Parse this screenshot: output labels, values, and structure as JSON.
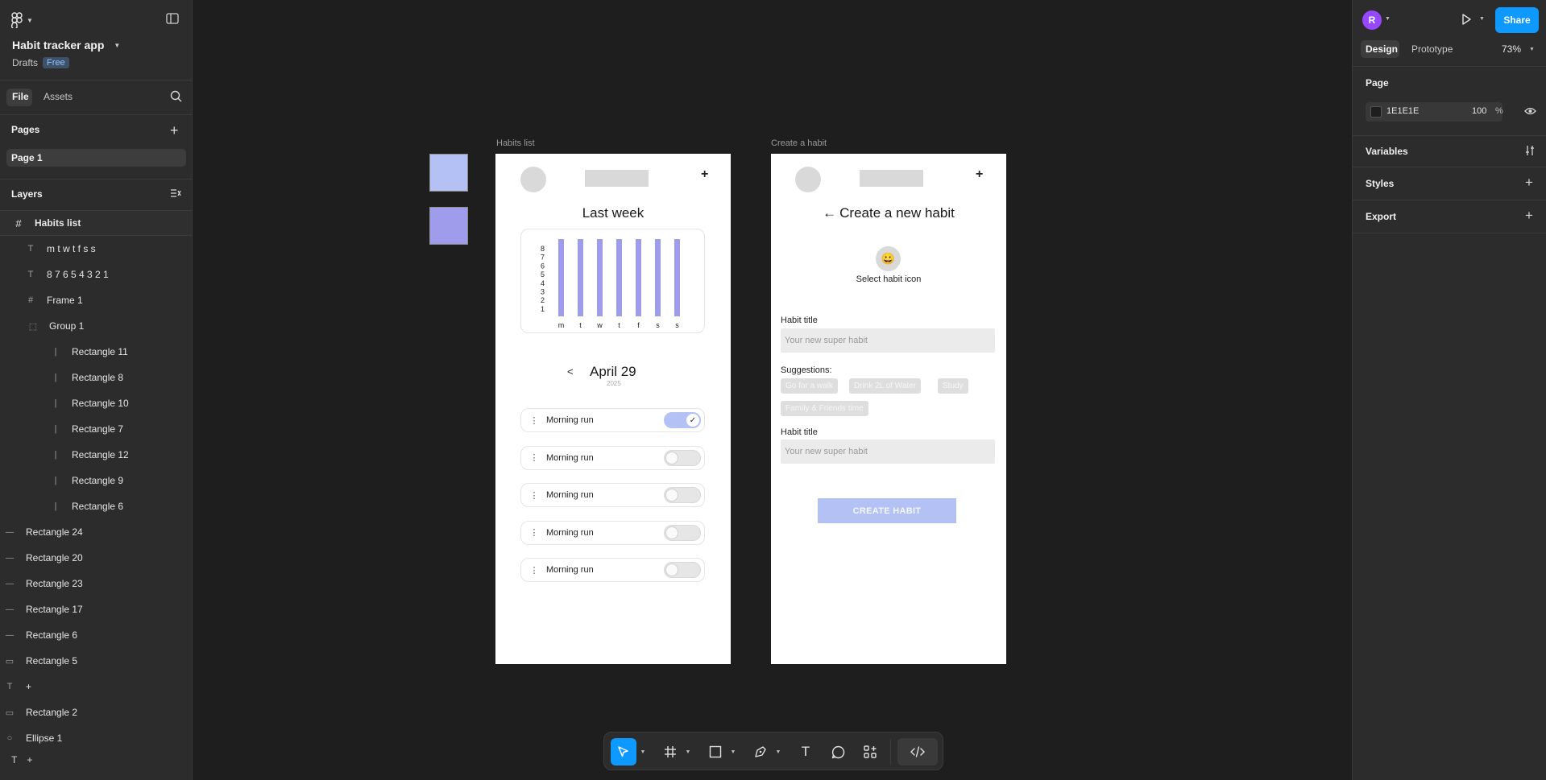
{
  "file": {
    "title": "Habit tracker app",
    "location": "Drafts",
    "plan_badge": "Free"
  },
  "left_tabs": {
    "file": "File",
    "assets": "Assets"
  },
  "pages": {
    "header": "Pages",
    "items": [
      "Page 1"
    ]
  },
  "layers": {
    "header": "Layers",
    "root": "Habits list",
    "items": [
      {
        "icon": "text-icon",
        "name": "m t w t f s s"
      },
      {
        "icon": "text-icon",
        "name": "8 7 6 5 4 3 2 1"
      },
      {
        "icon": "frame-icon",
        "name": "Frame 1"
      },
      {
        "icon": "group-icon",
        "name": "Group 1"
      },
      {
        "icon": "vline-icon",
        "name": "Rectangle 11"
      },
      {
        "icon": "vline-icon",
        "name": "Rectangle 8"
      },
      {
        "icon": "vline-icon",
        "name": "Rectangle 10"
      },
      {
        "icon": "vline-icon",
        "name": "Rectangle 7"
      },
      {
        "icon": "vline-icon",
        "name": "Rectangle 12"
      },
      {
        "icon": "vline-icon",
        "name": "Rectangle 9"
      },
      {
        "icon": "vline-icon",
        "name": "Rectangle 6"
      },
      {
        "icon": "hline-icon",
        "name": "Rectangle 24"
      },
      {
        "icon": "hline-icon",
        "name": "Rectangle 20"
      },
      {
        "icon": "hline-icon",
        "name": "Rectangle 23"
      },
      {
        "icon": "hline-icon",
        "name": "Rectangle 17"
      },
      {
        "icon": "hline-icon",
        "name": "Rectangle 6"
      },
      {
        "icon": "rect-icon",
        "name": "Rectangle 5"
      },
      {
        "icon": "text-icon",
        "name": "+"
      },
      {
        "icon": "rect-thin-icon",
        "name": "Rectangle 2"
      },
      {
        "icon": "ellipse-icon",
        "name": "Ellipse 1"
      }
    ],
    "bottom": "+"
  },
  "right": {
    "user_initial": "R",
    "share": "Share",
    "tabs": {
      "design": "Design",
      "prototype": "Prototype"
    },
    "zoom": "73%",
    "page_header": "Page",
    "page_color": "1E1E1E",
    "page_opacity": "100",
    "percent": "%",
    "variables": "Variables",
    "styles": "Styles",
    "export": "Export"
  },
  "canvas": {
    "swatches": [
      "#b4c1f5",
      "#9e9ceb"
    ],
    "habits_frame": {
      "label": "Habits list",
      "heading": "Last week",
      "chart_data": {
        "type": "bar",
        "categories": [
          "m",
          "t",
          "w",
          "t",
          "f",
          "s",
          "s"
        ],
        "values": [
          8,
          8,
          8,
          8,
          8,
          8,
          8
        ],
        "y_ticks": [
          "8",
          "7",
          "6",
          "5",
          "4",
          "3",
          "2",
          "1"
        ],
        "ylim": [
          0,
          8
        ],
        "color": "#9e9ceb"
      },
      "prev": "<",
      "date": "April 29",
      "year": "2025",
      "habits": [
        {
          "name": "Morning run",
          "on": true,
          "dots": "⋮",
          "check": "✓"
        },
        {
          "name": "Morning run",
          "on": false,
          "dots": "⋮"
        },
        {
          "name": "Morning run",
          "on": false,
          "dots": "⋮"
        },
        {
          "name": "Morning run",
          "on": false,
          "dots": "⋮"
        },
        {
          "name": "Morning run",
          "on": false,
          "dots": "⋮"
        }
      ],
      "plus": "+"
    },
    "create_frame": {
      "label": "Create a habit",
      "back": "←",
      "heading": "Create a new habit",
      "emoji": "😀",
      "icon_label": "Select habit icon",
      "field1_label": "Habit title",
      "field1_placeholder": "Your new super habit",
      "suggestions_label": "Suggestions:",
      "suggestions": [
        "Go for a walk",
        "Drink 2L of Water",
        "Study",
        "Family & Friends time"
      ],
      "field2_label": "Habit title",
      "field2_placeholder": "Your new super habit",
      "button": "CREATE HABIT",
      "button_color": "#b4c1f5",
      "plus": "+"
    }
  },
  "help": "?",
  "colors": {
    "accent": "#0d99ff",
    "avatar": "#9747ff",
    "page_bg": "#1e1e1e"
  }
}
